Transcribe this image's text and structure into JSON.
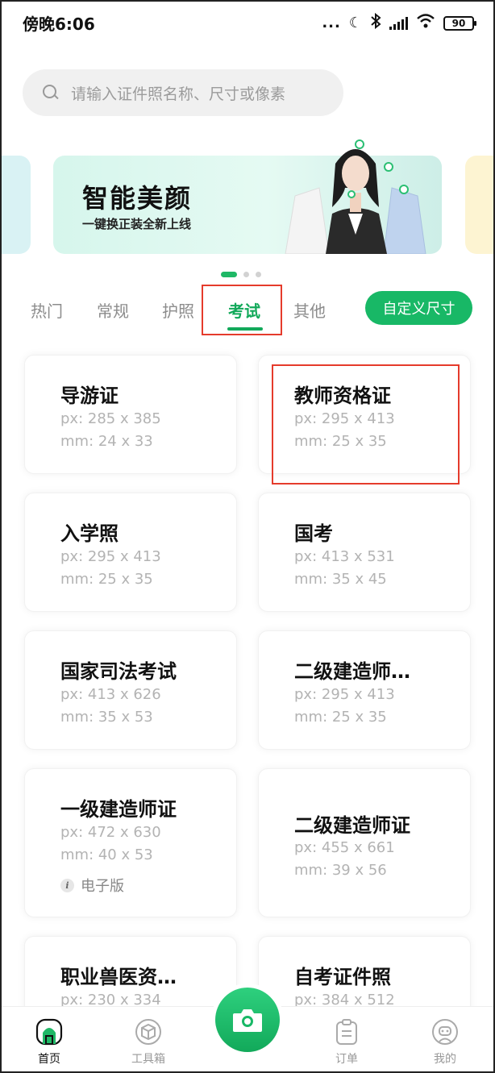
{
  "status_bar": {
    "time": "傍晚6:06",
    "dots": "...",
    "battery": "90"
  },
  "search": {
    "placeholder": "请输入证件照名称、尺寸或像素"
  },
  "banner": {
    "title": "智能美颜",
    "subtitle": "一键换正装全新上线",
    "page_count": 3,
    "active_page": 1
  },
  "tabs": {
    "items": [
      "热门",
      "常规",
      "护照",
      "考试",
      "其他"
    ],
    "active": "考试",
    "custom_button": "自定义尺寸"
  },
  "cards": [
    {
      "title": "导游证",
      "px": "px: 285 x 385",
      "mm": "mm: 24 x 33"
    },
    {
      "title": "教师资格证",
      "px": "px: 295 x 413",
      "mm": "mm: 25 x 35"
    },
    {
      "title": "入学照",
      "px": "px: 295 x 413",
      "mm": "mm: 25 x 35"
    },
    {
      "title": "国考",
      "px": "px: 413 x 531",
      "mm": "mm: 35 x 45"
    },
    {
      "title": "国家司法考试",
      "px": "px: 413 x 626",
      "mm": "mm: 35 x 53"
    },
    {
      "title": "二级建造师…",
      "px": "px: 295 x 413",
      "mm": "mm: 25 x 35"
    },
    {
      "title": "一级建造师证",
      "px": "px: 472 x 630",
      "mm": "mm: 40 x 53",
      "extra": "电子版"
    },
    {
      "title": "二级建造师证",
      "px": "px: 455 x 661",
      "mm": "mm: 39 x 56"
    },
    {
      "title": "职业兽医资…",
      "px": "px: 230 x 334"
    },
    {
      "title": "自考证件照",
      "px": "px: 384 x 512"
    }
  ],
  "bottom_nav": {
    "home": "首页",
    "toolbox": "工具箱",
    "orders": "订单",
    "mine": "我的"
  },
  "colors": {
    "accent": "#12a95a",
    "highlight": "#e53b2c"
  }
}
